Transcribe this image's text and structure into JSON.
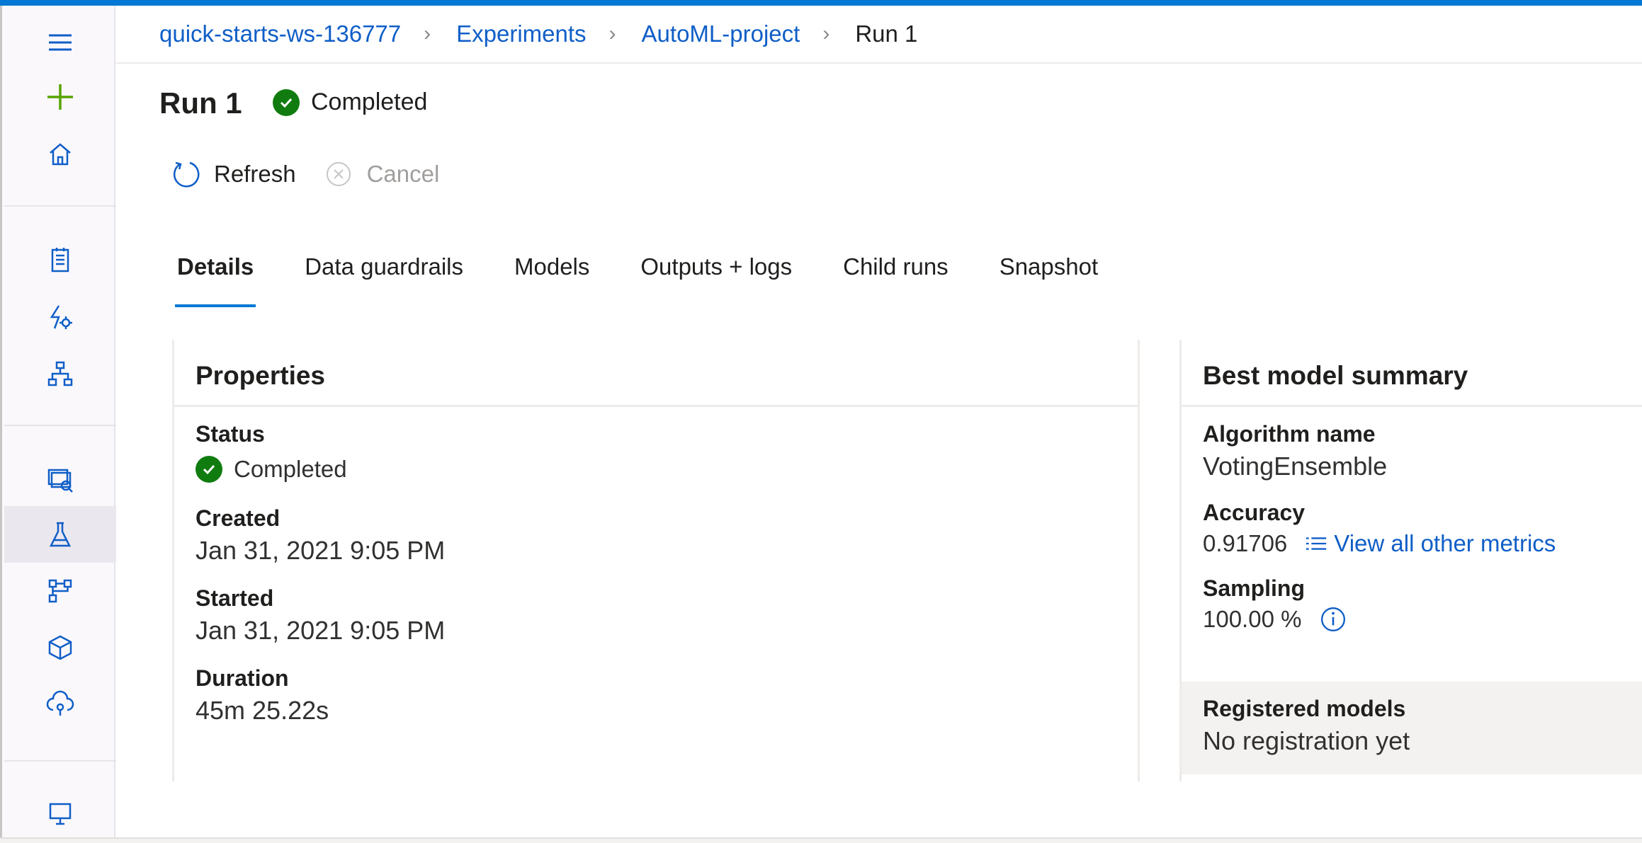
{
  "breadcrumb": {
    "workspace": "quick-starts-ws-136777",
    "experiments": "Experiments",
    "project": "AutoML-project",
    "current": "Run 1"
  },
  "page": {
    "title": "Run 1",
    "status": "Completed"
  },
  "toolbar": {
    "refresh": "Refresh",
    "cancel": "Cancel"
  },
  "tabs": [
    {
      "label": "Details",
      "active": true
    },
    {
      "label": "Data guardrails"
    },
    {
      "label": "Models"
    },
    {
      "label": "Outputs + logs"
    },
    {
      "label": "Child runs"
    },
    {
      "label": "Snapshot"
    }
  ],
  "properties": {
    "heading": "Properties",
    "status_label": "Status",
    "status_value": "Completed",
    "created_label": "Created",
    "created_value": "Jan 31, 2021 9:05 PM",
    "started_label": "Started",
    "started_value": "Jan 31, 2021 9:05 PM",
    "duration_label": "Duration",
    "duration_value": "45m 25.22s"
  },
  "summary": {
    "heading": "Best model summary",
    "algorithm_label": "Algorithm name",
    "algorithm_value": "VotingEnsemble",
    "accuracy_label": "Accuracy",
    "accuracy_value": "0.91706",
    "metrics_link": "View all other metrics",
    "sampling_label": "Sampling",
    "sampling_value": "100.00 %",
    "registered_label": "Registered models",
    "registered_value": "No registration yet"
  },
  "colors": {
    "accent": "#0078d4",
    "link": "#0f5ec7",
    "success": "#107c10"
  }
}
